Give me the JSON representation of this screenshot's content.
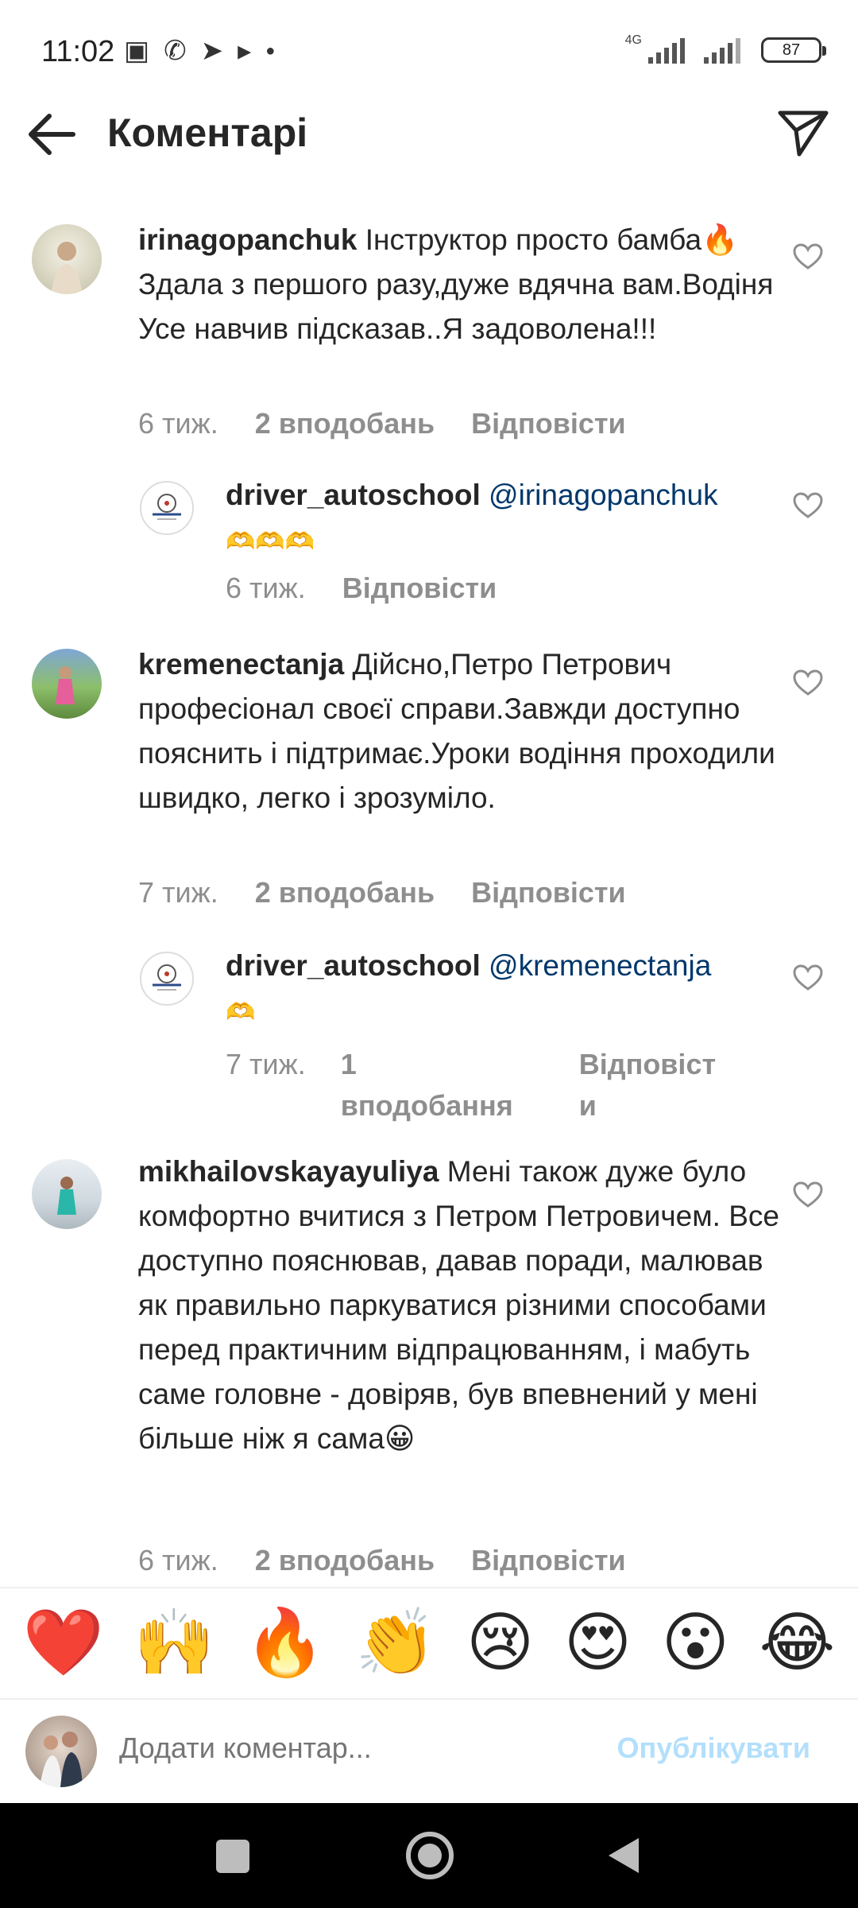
{
  "status_bar": {
    "time": "11:02",
    "network": "4G",
    "battery": "87",
    "icons": [
      "nfc-icon",
      "viber-icon",
      "telegram-icon",
      "play-icon",
      "dot-icon"
    ]
  },
  "header": {
    "title": "Коментарі"
  },
  "comments": [
    {
      "username": "irinagopanchuk",
      "text_parts": [
        "Інструктор просто бамба",
        "🔥",
        "Здала з першого разу,дуже вдячна вам.Водіня Усе навчив підсказав..Я задоволена!!!"
      ],
      "time": "6 тиж.",
      "likes": "2 вподобань",
      "reply": "Відповісти"
    },
    {
      "username": "driver_autoschool",
      "mention": "@irinagopanchuk",
      "emoji": "🫶🫶🫶",
      "time": "6 тиж.",
      "reply": "Відповісти"
    },
    {
      "username": "kremenectanja",
      "text": "Дійсно,Петро Петрович професіонал своєї справи.Завжди доступно пояснить і підтримає.Уроки водіння проходили швидко, легко і зрозуміло.",
      "time": "7 тиж.",
      "likes": "2 вподобань",
      "reply": "Відповісти"
    },
    {
      "username": "driver_autoschool",
      "mention": "@kremenectanja",
      "emoji": "🫶",
      "time": "7 тиж.",
      "likes_line1": "1",
      "likes_line2": "вподобання",
      "reply_line1": "Відповіст",
      "reply_line2": "и"
    },
    {
      "username": "mikhailovskayayuliya",
      "text": "Мені також дуже було комфортно вчитися з Петром Петровичем. Все доступно пояснював, давав поради, малював як правильно паркуватися різними способами перед практичним відпрацюванням,  і мабуть саме головне - довіряв, був впевнений у мені більше ніж я сама",
      "emoji": "😀",
      "time": "6 тиж.",
      "likes": "2 вподобань",
      "reply": "Відповісти"
    }
  ],
  "emoji_bar": [
    "❤️",
    "🙌",
    "🔥",
    "👏",
    "😢",
    "😍",
    "😮",
    "😂"
  ],
  "composer": {
    "placeholder": "Додати коментар...",
    "publish": "Опублікувати"
  },
  "colors": {
    "mention": "#00376b",
    "meta": "#8e8e8e",
    "publish_disabled": "#b2dffc",
    "text": "#262626"
  }
}
